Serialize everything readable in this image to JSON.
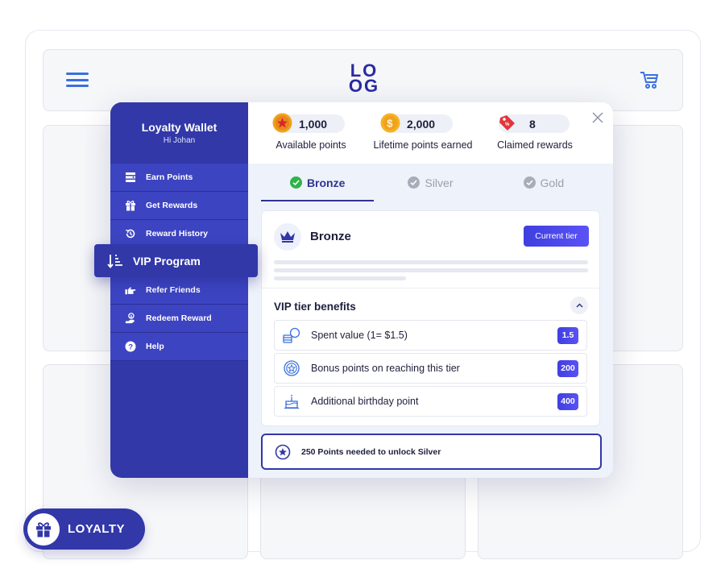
{
  "brand": {
    "logo_line1": "LO",
    "logo_line2": "OG"
  },
  "sidebar": {
    "title": "Loyalty Wallet",
    "greeting": "Hi Johan",
    "items": [
      {
        "label": "Earn Points",
        "icon": "earn-points-icon"
      },
      {
        "label": "Get Rewards",
        "icon": "gift-icon"
      },
      {
        "label": "Reward History",
        "icon": "history-icon"
      },
      {
        "label": "VIP Program",
        "icon": "vip-sort-icon",
        "active": true
      },
      {
        "label": "Refer Friends",
        "icon": "refer-hand-icon"
      },
      {
        "label": "Redeem Reward",
        "icon": "redeem-icon"
      },
      {
        "label": "Help",
        "icon": "help-icon"
      }
    ]
  },
  "stats": [
    {
      "value": "1,000",
      "label": "Available points",
      "icon": "star-coin-icon"
    },
    {
      "value": "2,000",
      "label": "Lifetime points earned",
      "icon": "dollar-coin-icon"
    },
    {
      "value": "8",
      "label": "Claimed rewards",
      "icon": "tag-icon"
    }
  ],
  "tabs": [
    {
      "label": "Bronze",
      "active": true
    },
    {
      "label": "Silver",
      "active": false
    },
    {
      "label": "Gold",
      "active": false
    }
  ],
  "tier": {
    "name": "Bronze",
    "status_button": "Current tier",
    "benefits_title": "VIP tier benefits",
    "benefits": [
      {
        "label": "Spent value (1= $1.5)",
        "value": "1.5",
        "icon": "coins-icon"
      },
      {
        "label": "Bonus points on reaching this tier",
        "value": "200",
        "icon": "star-badge-icon"
      },
      {
        "label": "Additional birthday point",
        "value": "400",
        "icon": "cake-icon"
      }
    ]
  },
  "unlock": {
    "text": "250 Points needed to unlock Silver"
  },
  "launcher": {
    "label": "LOYALTY"
  },
  "colors": {
    "primary": "#3238a8",
    "accent": "#4a49ea",
    "active_tab": "#2d3490"
  }
}
